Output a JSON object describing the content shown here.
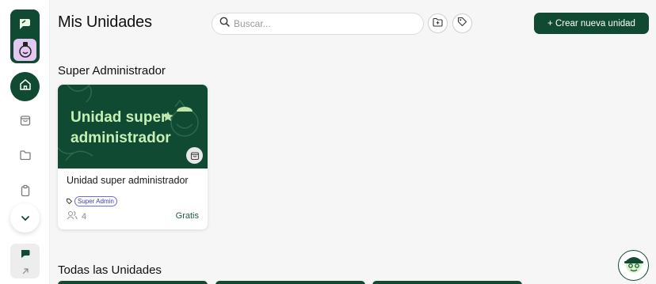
{
  "header": {
    "title": "Mis Unidades",
    "search_placeholder": "Buscar...",
    "create_button_label": "+ Crear nueva unidad"
  },
  "sections": {
    "super_admin_title": "Super Administrador",
    "all_units_title": "Todas las Unidades"
  },
  "unit_card": {
    "banner_text": "Unidad super administrador",
    "title": "Unidad super administrador",
    "tag": "Super Admin",
    "members_count": "4",
    "price": "Gratis"
  },
  "icons": {
    "logo": "chat-bubble-icon",
    "avatar": "person-avatar-icon",
    "home": "home-icon",
    "shop": "shopping-bag-icon",
    "folder": "folder-icon",
    "clipboard": "clipboard-icon",
    "expand": "chevron-down-icon",
    "search": "search-icon",
    "add_folder": "folder-plus-icon",
    "tag": "tag-icon",
    "members": "users-icon",
    "help": "support-avatar-icon"
  },
  "colors": {
    "brand": "#114a32",
    "banner_text": "#c6f0b5",
    "tag": "#3c3f9e",
    "background": "#f6f6f6"
  }
}
